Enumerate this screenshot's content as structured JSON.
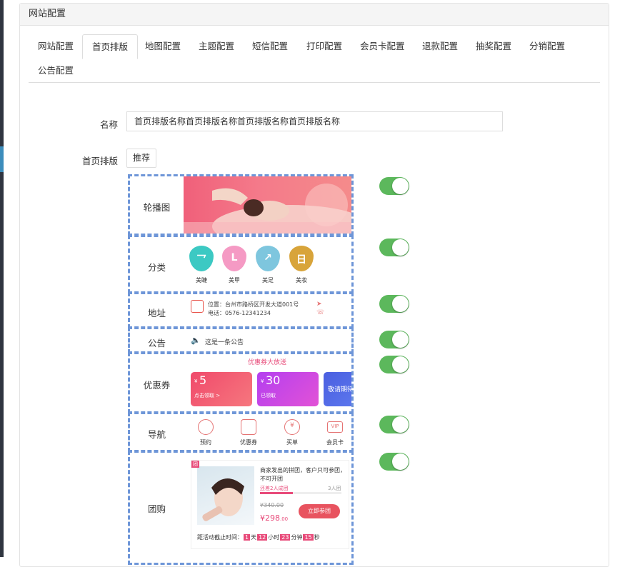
{
  "panel": {
    "title": "网站配置"
  },
  "tabs": [
    {
      "label": "网站配置"
    },
    {
      "label": "首页排版"
    },
    {
      "label": "地图配置"
    },
    {
      "label": "主题配置"
    },
    {
      "label": "短信配置"
    },
    {
      "label": "打印配置"
    },
    {
      "label": "会员卡配置"
    },
    {
      "label": "退款配置"
    },
    {
      "label": "抽奖配置"
    },
    {
      "label": "分销配置"
    },
    {
      "label": "公告配置"
    }
  ],
  "form": {
    "name_label": "名称",
    "name_value": "首页排版名称首页排版名称首页排版名称首页排版名称",
    "layout_label": "首页排版",
    "recommend_label": "推荐"
  },
  "modules": {
    "banner": {
      "label": "轮播图"
    },
    "category": {
      "label": "分类",
      "items": [
        "美睫",
        "美甲",
        "美足",
        "美妆"
      ]
    },
    "address": {
      "label": "地址",
      "location": "位置：台州市路桥区开发大道001号",
      "phone": "电话：0576-12341234"
    },
    "notice": {
      "label": "公告",
      "text": "这是一条公告"
    },
    "coupon": {
      "label": "优惠券",
      "headline": "优惠券大放送",
      "c1_amount": "5",
      "c1_sub": "点击领取 >",
      "c2_amount": "30",
      "c2_sub": "已领取",
      "c3_text": "敬请期待",
      "currency": "¥"
    },
    "nav": {
      "label": "导航",
      "items": [
        "预约",
        "优惠券",
        "买单",
        "会员卡"
      ],
      "vip": "VIP"
    },
    "group": {
      "label": "团购",
      "badge": "团",
      "desc": "商家发出的拼团，客户只可参团，不可开团",
      "progress_left": "还差2人成团",
      "progress_right": "3人团",
      "progress": 0.4,
      "old_price": "¥340.00",
      "price_int": "¥298",
      "price_dec": ".00",
      "join": "立即参团",
      "countdown_label": "距活动截止时间：",
      "cd_day": "1",
      "day_unit": "天",
      "cd_hour": "12",
      "hour_unit": "小时",
      "cd_min": "23",
      "min_unit": "分钟",
      "cd_sec": "15",
      "sec_unit": "秒"
    }
  },
  "colors": {
    "toggle_on": "#5cb85c",
    "dashed_border": "#6e96d8",
    "accent_pink": "#e84b7a"
  }
}
